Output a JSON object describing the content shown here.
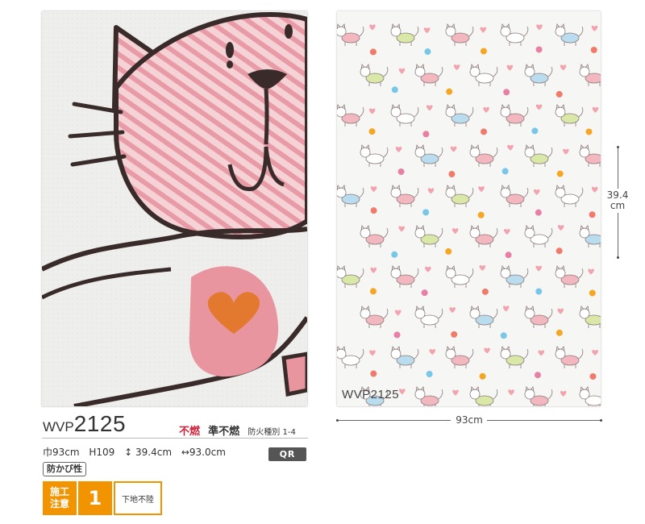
{
  "product": {
    "code_prefix": "WVP",
    "code_number": "2125",
    "pattern_code": "WVP2125"
  },
  "fire_rating": {
    "nonflammable": "不燃",
    "semi_nonflammable": "準不燃",
    "fire_class": "防火種別 1-4"
  },
  "specs": {
    "width": "巾93cm",
    "height": "H109",
    "repeat_vertical": "↕ 39.4cm",
    "repeat_horizontal": "↔93.0cm"
  },
  "qr_label": "QR",
  "mold_badge": "防かび性",
  "installation": {
    "label_line1": "施工",
    "label_line2": "注意",
    "number": "1",
    "description": "下地不陸"
  },
  "dimensions": {
    "width_label": "93cm",
    "height_value": "39.4",
    "height_unit": "cm"
  },
  "colors": {
    "accent_orange": "#f29400",
    "nonflammable_red": "#d0213a",
    "qr_gray": "#555555"
  },
  "icons": {
    "closeup": "cat-illustration-closeup",
    "pattern": "cat-wallpaper-pattern"
  }
}
